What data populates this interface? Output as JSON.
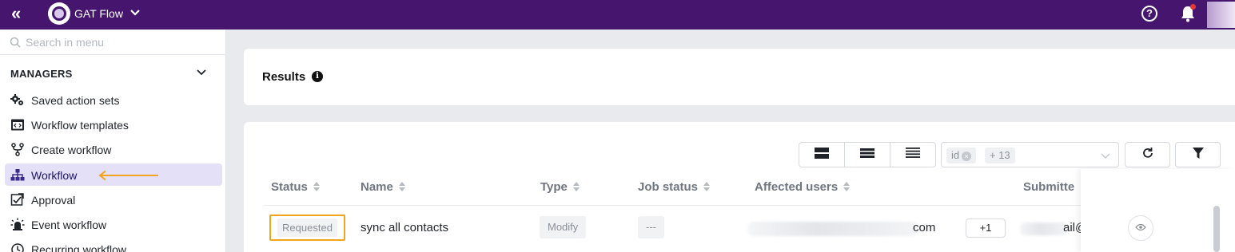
{
  "topbar": {
    "collapse_label": "«",
    "app_name": "GAT Flow",
    "help_label": "?",
    "accent_color": "#46166f"
  },
  "sidebar": {
    "search_placeholder": "Search in menu",
    "section_title": "MANAGERS",
    "items": [
      {
        "label": "Saved action sets",
        "icon": "gears-icon"
      },
      {
        "label": "Workflow templates",
        "icon": "template-icon"
      },
      {
        "label": "Create workflow",
        "icon": "branch-icon"
      },
      {
        "label": "Workflow",
        "icon": "hierarchy-icon",
        "active": true
      },
      {
        "label": "Approval",
        "icon": "approval-icon"
      },
      {
        "label": "Event workflow",
        "icon": "alarm-icon"
      },
      {
        "label": "Recurring workflow",
        "icon": "clock-icon"
      }
    ],
    "annotation_color": "#f2a41c"
  },
  "results": {
    "title": "Results",
    "info_label": "i"
  },
  "toolbar": {
    "view_buttons": [
      "large-rows-icon",
      "medium-rows-icon",
      "compact-rows-icon"
    ],
    "column_tags": [
      "id",
      "+ 13"
    ],
    "refresh_icon": "refresh-icon",
    "filter_icon": "filter-icon"
  },
  "table": {
    "columns": [
      "Status",
      "Name",
      "Type",
      "Job status",
      "Affected users",
      "Submitte"
    ],
    "rows": [
      {
        "status": "Requested",
        "name": "sync all contacts",
        "type": "Modify",
        "job_status": "---",
        "affected_users_suffix": "com",
        "affected_users_more": "+1",
        "submitted_partial": "ail@"
      }
    ]
  }
}
